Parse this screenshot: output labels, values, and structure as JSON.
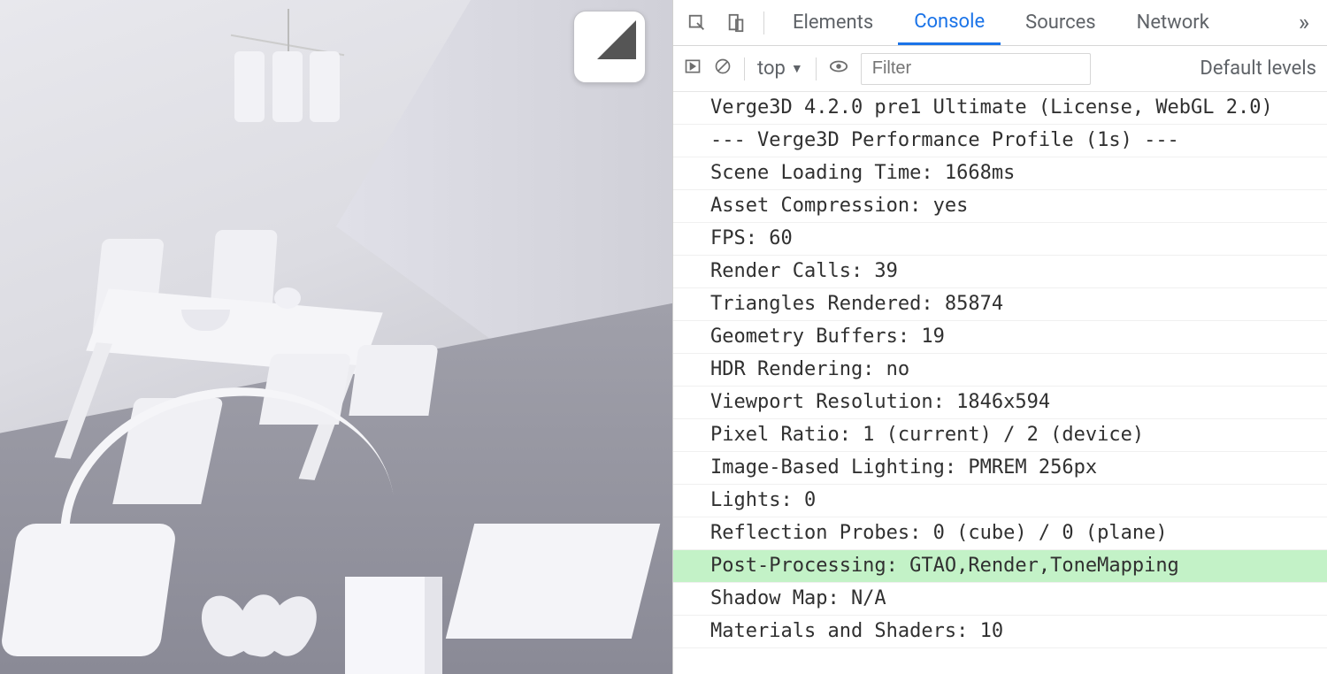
{
  "devtools": {
    "tabs": {
      "elements": "Elements",
      "console": "Console",
      "sources": "Sources",
      "network": "Network",
      "active": "console"
    },
    "toolbar": {
      "context": "top",
      "filter_placeholder": "Filter",
      "levels": "Default levels"
    },
    "log": [
      {
        "text": "Verge3D 4.2.0 pre1 Ultimate (License, WebGL 2.0)",
        "hl": false
      },
      {
        "text": "--- Verge3D Performance Profile (1s) ---",
        "hl": false
      },
      {
        "text": "Scene Loading Time: 1668ms",
        "hl": false
      },
      {
        "text": "Asset Compression: yes",
        "hl": false
      },
      {
        "text": "FPS: 60",
        "hl": false
      },
      {
        "text": "Render Calls: 39",
        "hl": false
      },
      {
        "text": "Triangles Rendered: 85874",
        "hl": false
      },
      {
        "text": "Geometry Buffers: 19",
        "hl": false
      },
      {
        "text": "HDR Rendering: no",
        "hl": false
      },
      {
        "text": "Viewport Resolution: 1846x594",
        "hl": false
      },
      {
        "text": "Pixel Ratio: 1 (current) / 2 (device)",
        "hl": false
      },
      {
        "text": "Image-Based Lighting: PMREM 256px",
        "hl": false
      },
      {
        "text": "Lights: 0",
        "hl": false
      },
      {
        "text": "Reflection Probes: 0 (cube) / 0 (plane)",
        "hl": false
      },
      {
        "text": "Post-Processing: GTAO,Render,ToneMapping",
        "hl": true
      },
      {
        "text": "Shadow Map: N/A",
        "hl": false
      },
      {
        "text": "Materials and Shaders: 10",
        "hl": false
      }
    ]
  },
  "viewport": {
    "corner_button": "fullscreen-fold"
  }
}
